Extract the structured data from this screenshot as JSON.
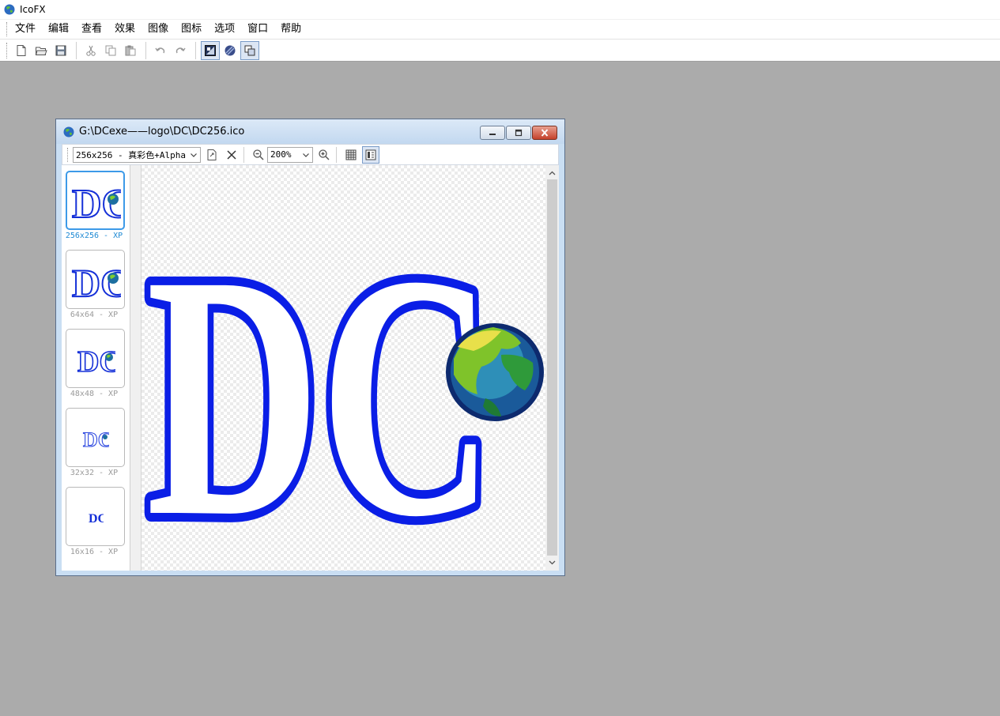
{
  "app": {
    "title": "IcoFX"
  },
  "menu": [
    "文件",
    "编辑",
    "查看",
    "效果",
    "图像",
    "图标",
    "选项",
    "窗口",
    "帮助"
  ],
  "toolbar": {
    "buttons": [
      {
        "name": "new-file-icon"
      },
      {
        "name": "open-folder-icon"
      },
      {
        "name": "save-icon"
      },
      {
        "name": "cut-icon"
      },
      {
        "name": "copy-icon"
      },
      {
        "name": "paste-icon"
      },
      {
        "name": "undo-icon"
      },
      {
        "name": "redo-icon"
      },
      {
        "name": "image-editor-icon"
      },
      {
        "name": "globe-icon"
      },
      {
        "name": "layers-icon"
      }
    ]
  },
  "document": {
    "title": "G:\\DCexe——logo\\DC\\DC256.ico",
    "format_value": "256x256 - 真彩色+Alpha",
    "zoom_value": "200%",
    "thumbnails": [
      {
        "label": "256x256 - XP",
        "selected": true
      },
      {
        "label": "64x64 - XP",
        "selected": false
      },
      {
        "label": "48x48 - XP",
        "selected": false
      },
      {
        "label": "32x32 - XP",
        "selected": false
      },
      {
        "label": "16x16 - XP",
        "selected": false
      }
    ],
    "logo_text": "DC"
  },
  "colors": {
    "logo_blue": "#0a1ee6",
    "background": "#ababab",
    "selection": "#3d9ae8"
  }
}
